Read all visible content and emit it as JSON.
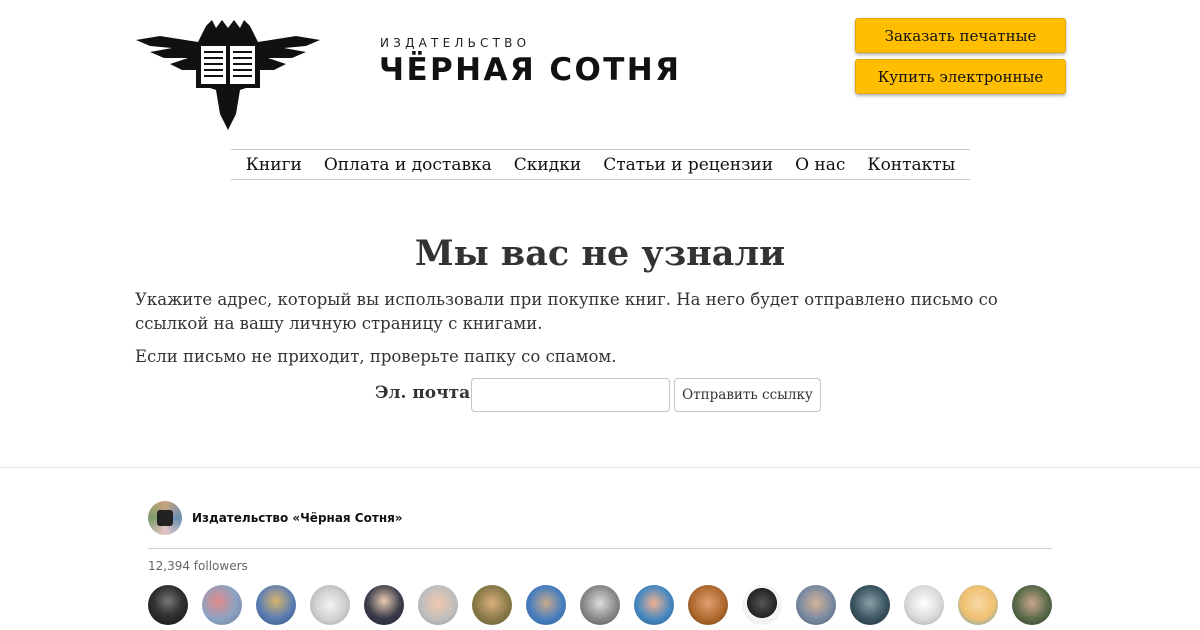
{
  "header": {
    "logo_small": "ИЗДАТЕЛЬСТВО",
    "logo_big": "ЧЁРНАЯ СОТНЯ",
    "btn_print": "Заказать печатные",
    "btn_ebook": "Купить электронные"
  },
  "nav": {
    "items": [
      "Книги",
      "Оплата и доставка",
      "Скидки",
      "Статьи и рецензии",
      "О нас",
      "Контакты"
    ]
  },
  "main": {
    "title": "Мы вас не узнали",
    "description": "Укажите адрес, который вы использовали при покупке книг. На него будет отправлено письмо со ссылкой на вашу личную страницу с книгами.",
    "spam_note": "Если письмо не приходит, проверьте папку со спамом.",
    "email_label": "Эл. почта:",
    "email_value": "",
    "send_button": "Отправить ссылку"
  },
  "widget": {
    "name": "Издательство «Чёрная Сотня»",
    "followers": "12,394 followers",
    "colors": {
      "accent": "#ffbf00"
    }
  }
}
